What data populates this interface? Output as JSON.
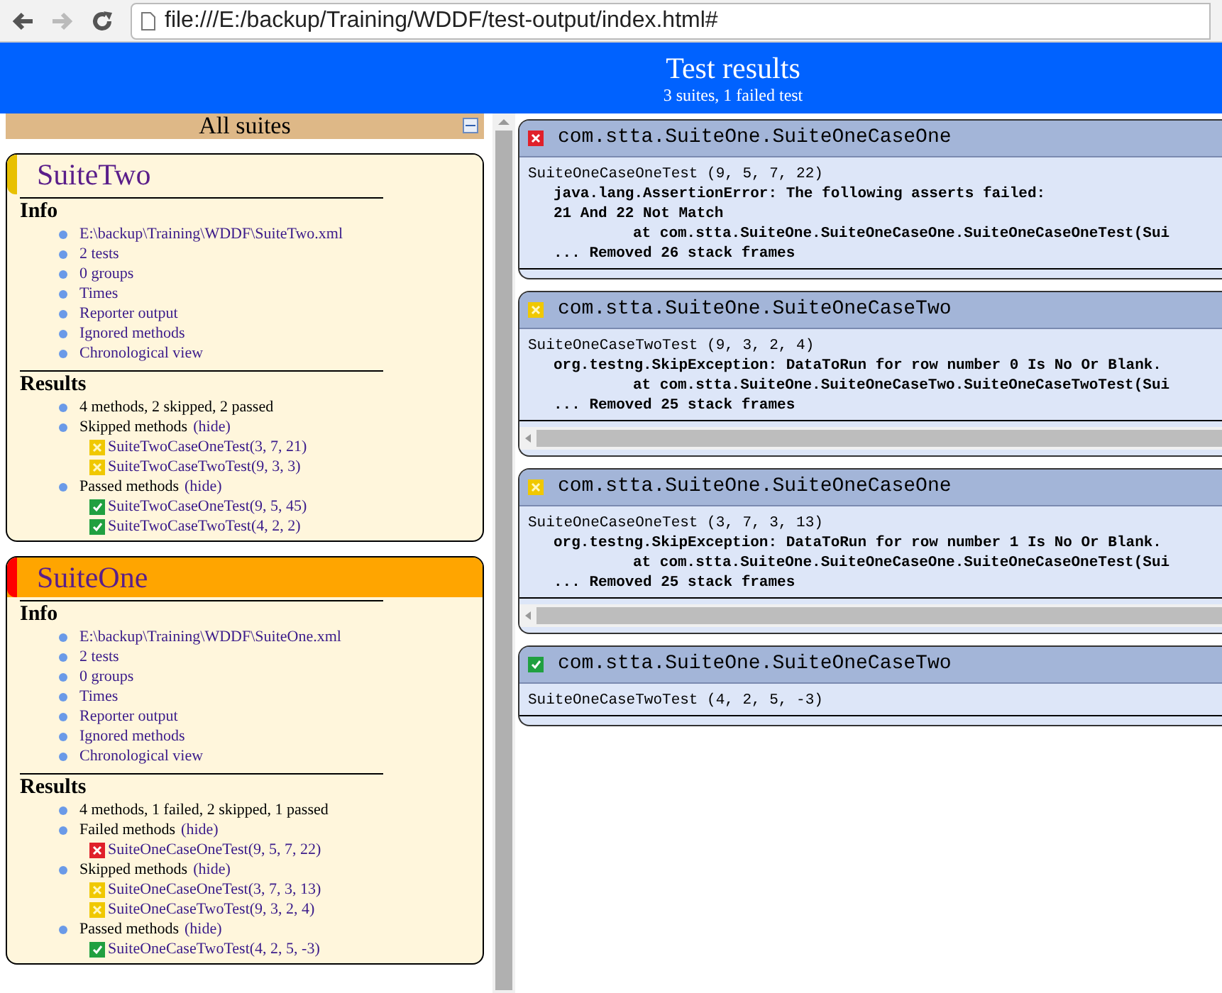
{
  "browser": {
    "url": "file:///E:/backup/Training/WDDF/test-output/index.html#",
    "forward_disabled": true
  },
  "header": {
    "title": "Test results",
    "subtitle": "3 suites, 1 failed test"
  },
  "suites_panel": {
    "title": "All suites",
    "suites": [
      {
        "name": "SuiteTwo",
        "kind": "skipped",
        "info_title": "Info",
        "info": [
          "E:\\backup\\Training\\WDDF\\SuiteTwo.xml",
          "2 tests",
          "0 groups",
          "Times",
          "Reporter output",
          "Ignored methods",
          "Chronological view"
        ],
        "results_title": "Results",
        "results": [
          {
            "label": "4 methods, 2 skipped, 2 passed"
          },
          {
            "label": "Skipped methods",
            "link": "(hide)",
            "methods": [
              {
                "name": "SuiteTwoCaseOneTest(3, 7, 21)",
                "kind": "skipped"
              },
              {
                "name": "SuiteTwoCaseTwoTest(9, 3, 3)",
                "kind": "skipped"
              }
            ]
          },
          {
            "label": "Passed methods",
            "link": "(hide)",
            "methods": [
              {
                "name": "SuiteTwoCaseOneTest(9, 5, 45)",
                "kind": "passed"
              },
              {
                "name": "SuiteTwoCaseTwoTest(4, 2, 2)",
                "kind": "passed"
              }
            ]
          }
        ]
      },
      {
        "name": "SuiteOne",
        "kind": "failed",
        "info_title": "Info",
        "info": [
          "E:\\backup\\Training\\WDDF\\SuiteOne.xml",
          "2 tests",
          "0 groups",
          "Times",
          "Reporter output",
          "Ignored methods",
          "Chronological view"
        ],
        "results_title": "Results",
        "results": [
          {
            "label": "4 methods, 1 failed, 2 skipped, 1 passed"
          },
          {
            "label": "Failed methods",
            "link": "(hide)",
            "methods": [
              {
                "name": "SuiteOneCaseOneTest(9, 5, 7, 22)",
                "kind": "failed"
              }
            ]
          },
          {
            "label": "Skipped methods",
            "link": "(hide)",
            "methods": [
              {
                "name": "SuiteOneCaseOneTest(3, 7, 3, 13)",
                "kind": "skipped"
              },
              {
                "name": "SuiteOneCaseTwoTest(9, 3, 2, 4)",
                "kind": "skipped"
              }
            ]
          },
          {
            "label": "Passed methods",
            "link": "(hide)",
            "methods": [
              {
                "name": "SuiteOneCaseTwoTest(4, 2, 5, -3)",
                "kind": "passed"
              }
            ]
          }
        ]
      }
    ]
  },
  "results_panel": {
    "cards": [
      {
        "title": "com.stta.SuiteOne.SuiteOneCaseOne",
        "kind": "failed",
        "test": "SuiteOneCaseOneTest (9, 5, 7, 22)",
        "h_scrollbar": false,
        "lines": [
          {
            "kind": "message",
            "text": "java.lang.AssertionError: The following asserts failed:"
          },
          {
            "kind": "message",
            "text": "21 And 22 Not Match"
          },
          {
            "kind": "at",
            "text": "at com.stta.SuiteOne.SuiteOneCaseOne.SuiteOneCaseOneTest(Sui"
          },
          {
            "kind": "message",
            "text": "... Removed 26 stack frames"
          }
        ]
      },
      {
        "title": "com.stta.SuiteOne.SuiteOneCaseTwo",
        "kind": "skipped",
        "test": "SuiteOneCaseTwoTest (9, 3, 2, 4)",
        "h_scrollbar": true,
        "lines": [
          {
            "kind": "message",
            "text": "org.testng.SkipException: DataToRun for row number 0 Is No Or Blank."
          },
          {
            "kind": "at",
            "text": "at com.stta.SuiteOne.SuiteOneCaseTwo.SuiteOneCaseTwoTest(Sui"
          },
          {
            "kind": "message",
            "text": "... Removed 25 stack frames"
          }
        ]
      },
      {
        "title": "com.stta.SuiteOne.SuiteOneCaseOne",
        "kind": "skipped",
        "test": "SuiteOneCaseOneTest (3, 7, 3, 13)",
        "h_scrollbar": true,
        "lines": [
          {
            "kind": "message",
            "text": "org.testng.SkipException: DataToRun for row number 1 Is No Or Blank."
          },
          {
            "kind": "at",
            "text": "at com.stta.SuiteOne.SuiteOneCaseOne.SuiteOneCaseOneTest(Sui"
          },
          {
            "kind": "message",
            "text": "... Removed 25 stack frames"
          }
        ]
      },
      {
        "title": "com.stta.SuiteOne.SuiteOneCaseTwo",
        "kind": "passed",
        "test": "SuiteOneCaseTwoTest (4, 2, 5, -3)",
        "h_scrollbar": false
      }
    ]
  }
}
